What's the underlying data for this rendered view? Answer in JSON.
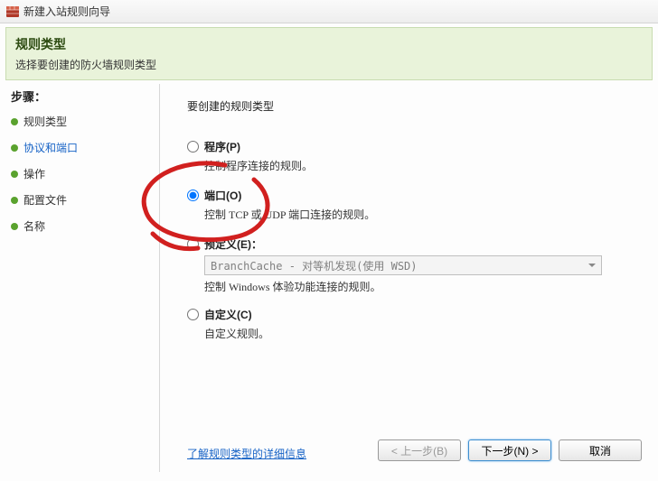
{
  "window": {
    "title": "新建入站规则向导"
  },
  "header": {
    "title": "规则类型",
    "subtitle": "选择要创建的防火墙规则类型"
  },
  "sidebar": {
    "label": "步骤：",
    "items": [
      {
        "label": "规则类型",
        "active": false
      },
      {
        "label": "协议和端口",
        "active": true
      },
      {
        "label": "操作",
        "active": false
      },
      {
        "label": "配置文件",
        "active": false
      },
      {
        "label": "名称",
        "active": false
      }
    ]
  },
  "main": {
    "heading": "要创建的规则类型",
    "options": {
      "program": {
        "label": "程序(P)",
        "desc": "控制程序连接的规则。",
        "selected": false
      },
      "port": {
        "label": "端口(O)",
        "desc": "控制 TCP 或 UDP 端口连接的规则。",
        "selected": true
      },
      "predefined": {
        "label": "预定义(E)：",
        "desc": "控制 Windows 体验功能连接的规则。",
        "selected": false,
        "dropdown": "BranchCache - 对等机发现(使用 WSD)"
      },
      "custom": {
        "label": "自定义(C)",
        "desc": "自定义规则。",
        "selected": false
      }
    },
    "learn_link": "了解规则类型的详细信息"
  },
  "buttons": {
    "back": "< 上一步(B)",
    "next": "下一步(N) >",
    "cancel": "取消"
  }
}
